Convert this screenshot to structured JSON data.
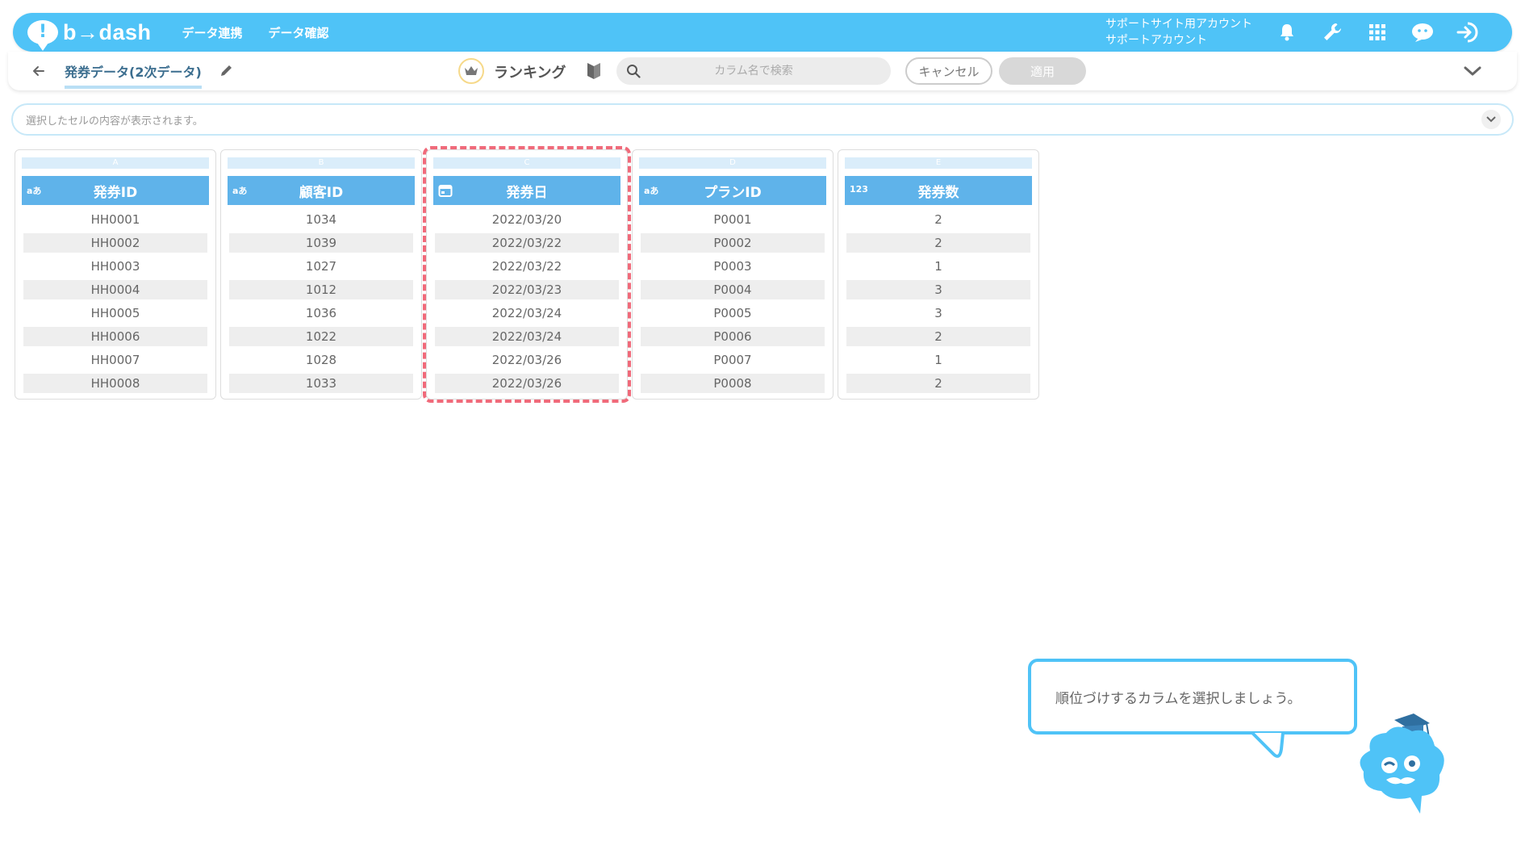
{
  "app": {
    "logo_mark": "!",
    "logo_text": "b→dash",
    "nav": [
      "データ連携",
      "データ確認"
    ],
    "account_line1": "サポートサイト用アカウント",
    "account_line2": "サポートアカウント",
    "icons": [
      "bell-icon",
      "wrench-icon",
      "grid-icon",
      "chat-icon",
      "logout-icon"
    ]
  },
  "toolbar": {
    "tab_title": "発券データ(2次データ)",
    "mode_label": "ランキング",
    "search_placeholder": "カラム名で検索",
    "cancel_label": "キャンセル",
    "apply_label": "適用"
  },
  "cellbar": {
    "placeholder": "選択したセルの内容が表示されます。"
  },
  "columns": [
    {
      "letter": "A",
      "type": "aあ",
      "name": "発券ID",
      "rows": [
        "HH0001",
        "HH0002",
        "HH0003",
        "HH0004",
        "HH0005",
        "HH0006",
        "HH0007",
        "HH0008"
      ]
    },
    {
      "letter": "B",
      "type": "aあ",
      "name": "顧客ID",
      "rows": [
        "1034",
        "1039",
        "1027",
        "1012",
        "1036",
        "1022",
        "1028",
        "1033"
      ]
    },
    {
      "letter": "C",
      "type": "date",
      "name": "発券日",
      "rows": [
        "2022/03/20",
        "2022/03/22",
        "2022/03/22",
        "2022/03/23",
        "2022/03/24",
        "2022/03/24",
        "2022/03/26",
        "2022/03/26"
      ]
    },
    {
      "letter": "D",
      "type": "aあ",
      "name": "プランID",
      "rows": [
        "P0001",
        "P0002",
        "P0003",
        "P0004",
        "P0005",
        "P0006",
        "P0007",
        "P0008"
      ]
    },
    {
      "letter": "E",
      "type": "123",
      "name": "発券数",
      "rows": [
        "2",
        "2",
        "1",
        "3",
        "3",
        "2",
        "1",
        "2"
      ]
    }
  ],
  "guide": {
    "message": "順位づけするカラムを選択しましょう。"
  },
  "colors": {
    "header_blue": "#4fc3f7",
    "column_header": "#5fb3ea",
    "highlight": "#f06a7a"
  }
}
